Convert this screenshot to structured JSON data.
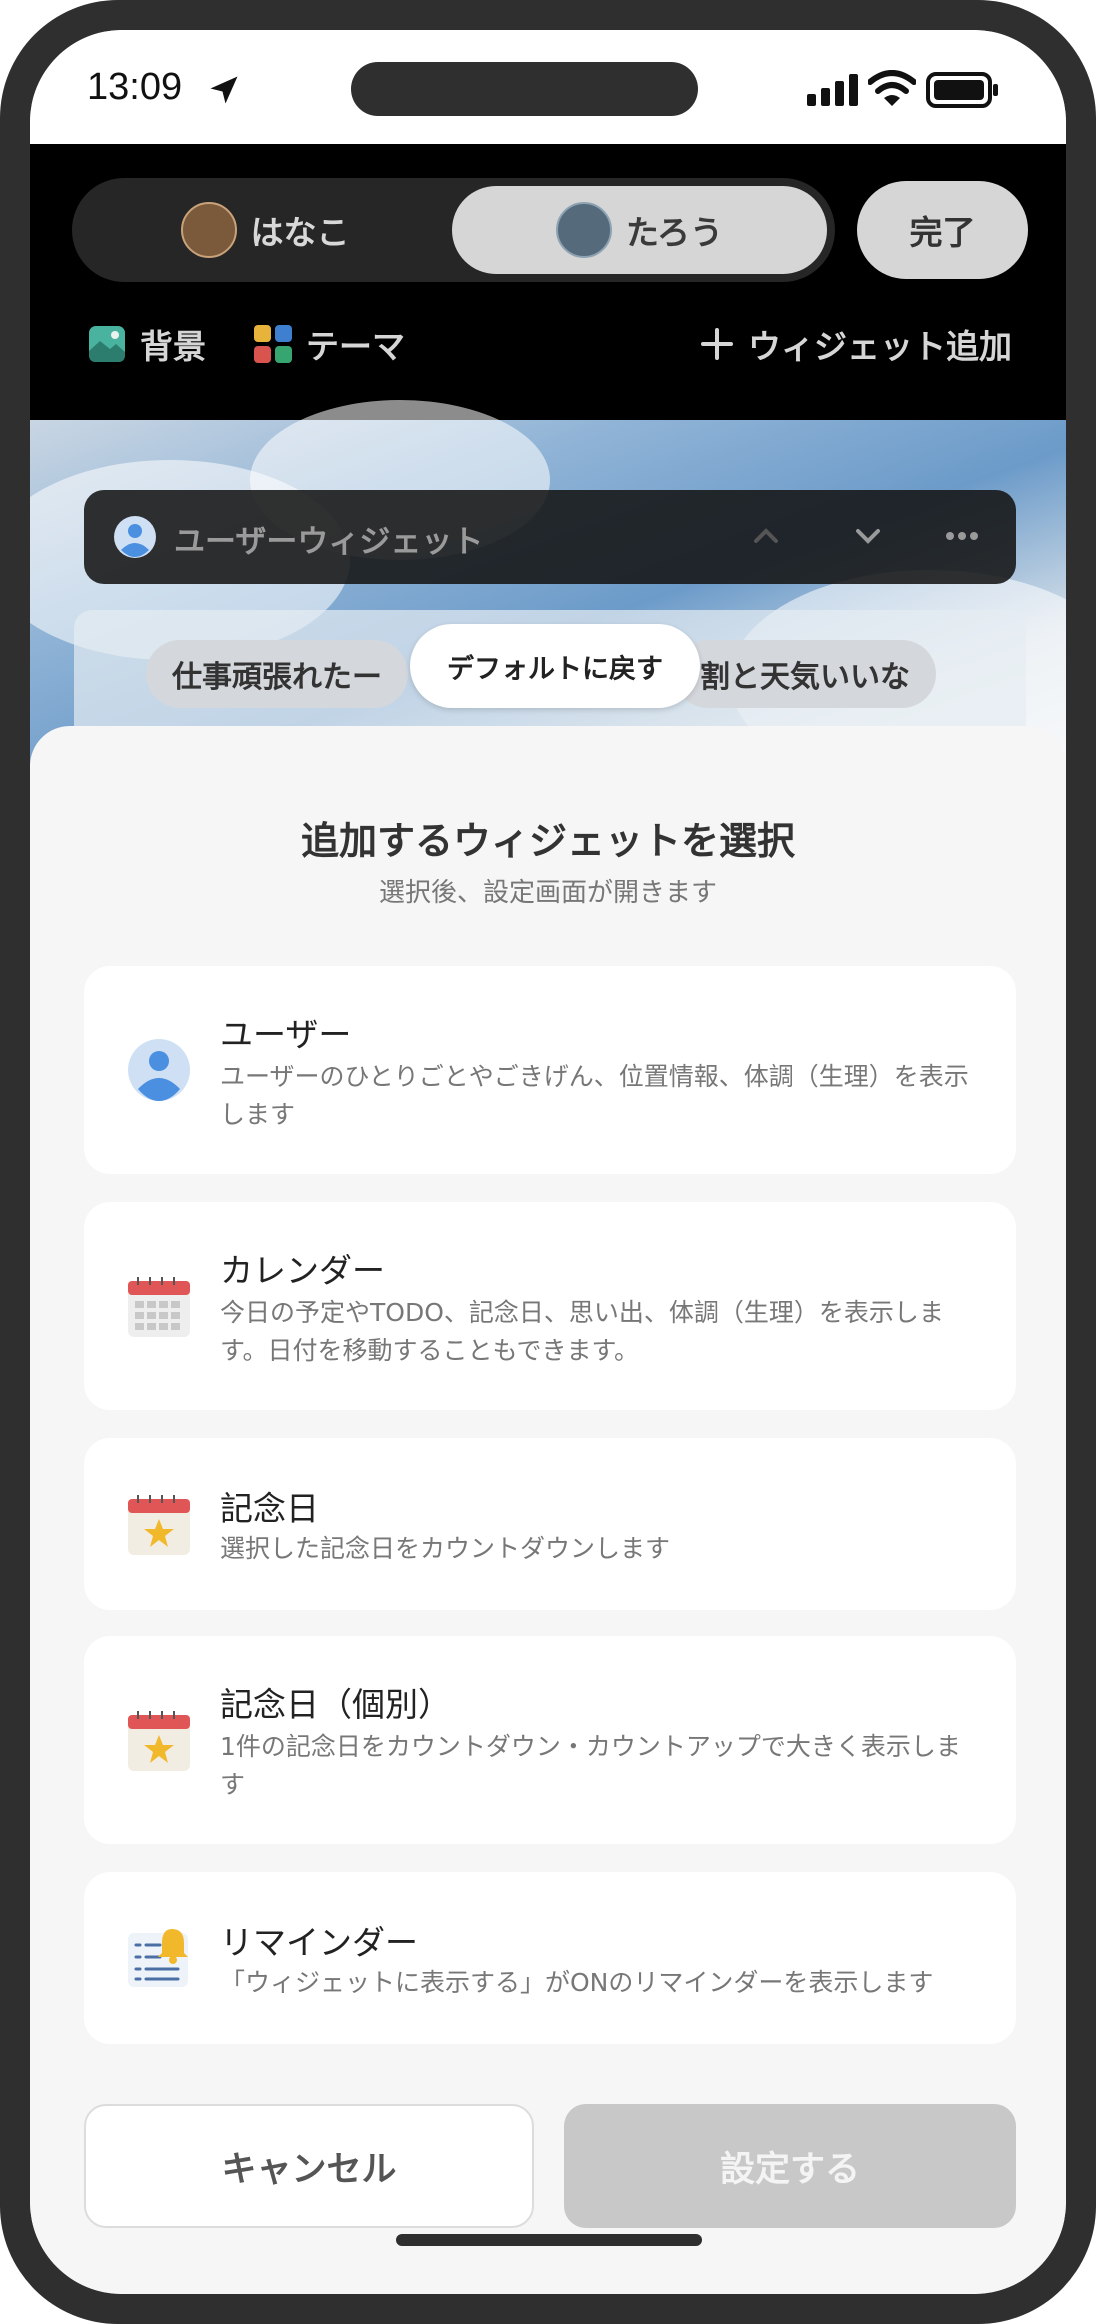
{
  "status": {
    "time": "13:09"
  },
  "header": {
    "users": [
      {
        "name": "はなこ"
      },
      {
        "name": "たろう"
      }
    ],
    "done_label": "完了",
    "tools": {
      "background": "背景",
      "theme": "テーマ",
      "add_widget": "ウィジェット追加"
    }
  },
  "preview": {
    "widget_bar_label": "ユーザーウィジェット",
    "chip_left": "仕事頑張れたー",
    "chip_right": "割と天気いいな",
    "tooltip": "デフォルトに戻す"
  },
  "sheet": {
    "title": "追加するウィジェットを選択",
    "subtitle": "選択後、設定画面が開きます",
    "items": [
      {
        "name": "ユーザー",
        "desc": "ユーザーのひとりごとやごきげん、位置情報、体調（生理）を表示します",
        "icon": "user-icon"
      },
      {
        "name": "カレンダー",
        "desc": "今日の予定やTODO、記念日、思い出、体調（生理）を表示します。日付を移動することもできます。",
        "icon": "calendar-icon"
      },
      {
        "name": "記念日",
        "desc": "選択した記念日をカウントダウンします",
        "icon": "anniversary-icon"
      },
      {
        "name": "記念日（個別）",
        "desc": "1件の記念日をカウントダウン・カウントアップで大きく表示します",
        "icon": "anniversary-icon"
      },
      {
        "name": "リマインダー",
        "desc": "「ウィジェットに表示する」がONのリマインダーを表示します",
        "icon": "reminder-icon"
      }
    ],
    "cancel_label": "キャンセル",
    "set_label": "設定する"
  }
}
